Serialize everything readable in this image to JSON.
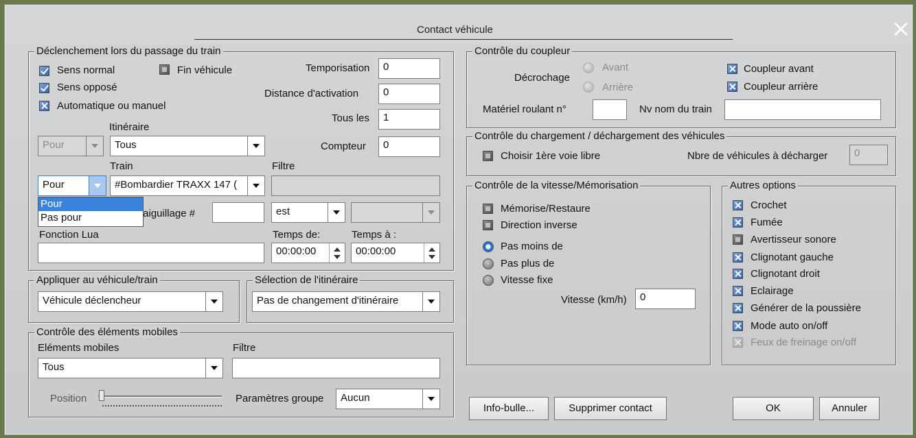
{
  "window": {
    "title": "Contact véhicule",
    "close": "×"
  },
  "trigger_group": {
    "legend": "Déclenchement lors du passage du train",
    "sens_normal": "Sens normal",
    "fin_vehicule": "Fin véhicule",
    "sens_oppose": "Sens opposé",
    "auto_manuel": "Automatique ou manuel",
    "temporisation_label": "Temporisation",
    "temporisation_value": "0",
    "distance_label": "Distance d'activation",
    "distance_value": "0",
    "tous_les_label": "Tous les",
    "tous_les_value": "1",
    "compteur_label": "Compteur",
    "compteur_value": "0",
    "itineraire_label": "Itinéraire",
    "pour_disabled_value": "Pour",
    "itineraire_value": "Tous",
    "train_label": "Train",
    "filtre_label": "Filtre",
    "pour_value": "Pour",
    "train_value": "#Bombardier TRAXX 147 (",
    "aiguillage_label": "/aiguillage #",
    "est_value": "est",
    "fonction_lua_label": "Fonction Lua",
    "temps_de_label": "Temps de:",
    "temps_de_value": "00:00:00",
    "temps_a_label": "Temps à :",
    "temps_a_value": "00:00:00",
    "dropdown_options": [
      "Pour",
      "Pas pour"
    ]
  },
  "apply_group": {
    "legend": "Appliquer au véhicule/train",
    "value": "Véhicule déclencheur"
  },
  "route_group": {
    "legend": "Sélection de l'itinéraire",
    "value": "Pas de changement d'itinéraire"
  },
  "mobile_group": {
    "legend": "Contrôle des éléments mobiles",
    "elements_label": "Eléments mobiles",
    "elements_value": "Tous",
    "filtre_label": "Filtre",
    "position_label": "Position",
    "params_label": "Paramètres groupe",
    "params_value": "Aucun"
  },
  "coupler_group": {
    "legend": "Contrôle du coupleur",
    "decrochage_label": "Décrochage",
    "avant": "Avant",
    "arriere": "Arrière",
    "coupleur_avant": "Coupleur avant",
    "coupleur_arriere": "Coupleur arrière",
    "materiel_label": "Matériel roulant n°",
    "nv_nom_label": "Nv nom du train"
  },
  "load_group": {
    "legend": "Contrôle du chargement / déchargement des véhicules",
    "choisir": "Choisir 1ère voie libre",
    "nbre_label": "Nbre de véhicules à décharger",
    "nbre_value": "0"
  },
  "speed_group": {
    "legend": "Contrôle de la vitesse/Mémorisation",
    "memorise": "Mémorise/Restaure",
    "direction": "Direction inverse",
    "pas_moins": "Pas moins de",
    "pas_plus": "Pas plus de",
    "vitesse_fixe": "Vitesse fixe",
    "vitesse_label": "Vitesse (km/h)",
    "vitesse_value": "0"
  },
  "other_group": {
    "legend": "Autres options",
    "crochet": "Crochet",
    "fumee": "Fumée",
    "avertisseur": "Avertisseur sonore",
    "clign_gauche": "Clignotant gauche",
    "clign_droit": "Clignotant droit",
    "eclairage": "Eclairage",
    "poussiere": "Générer de la poussière",
    "mode_auto": "Mode auto on/off",
    "feux_frein": "Feux de freinage on/off"
  },
  "buttons": {
    "info_bulle": "Info-bulle...",
    "supprimer": "Supprimer contact",
    "ok": "OK",
    "annuler": "Annuler"
  }
}
